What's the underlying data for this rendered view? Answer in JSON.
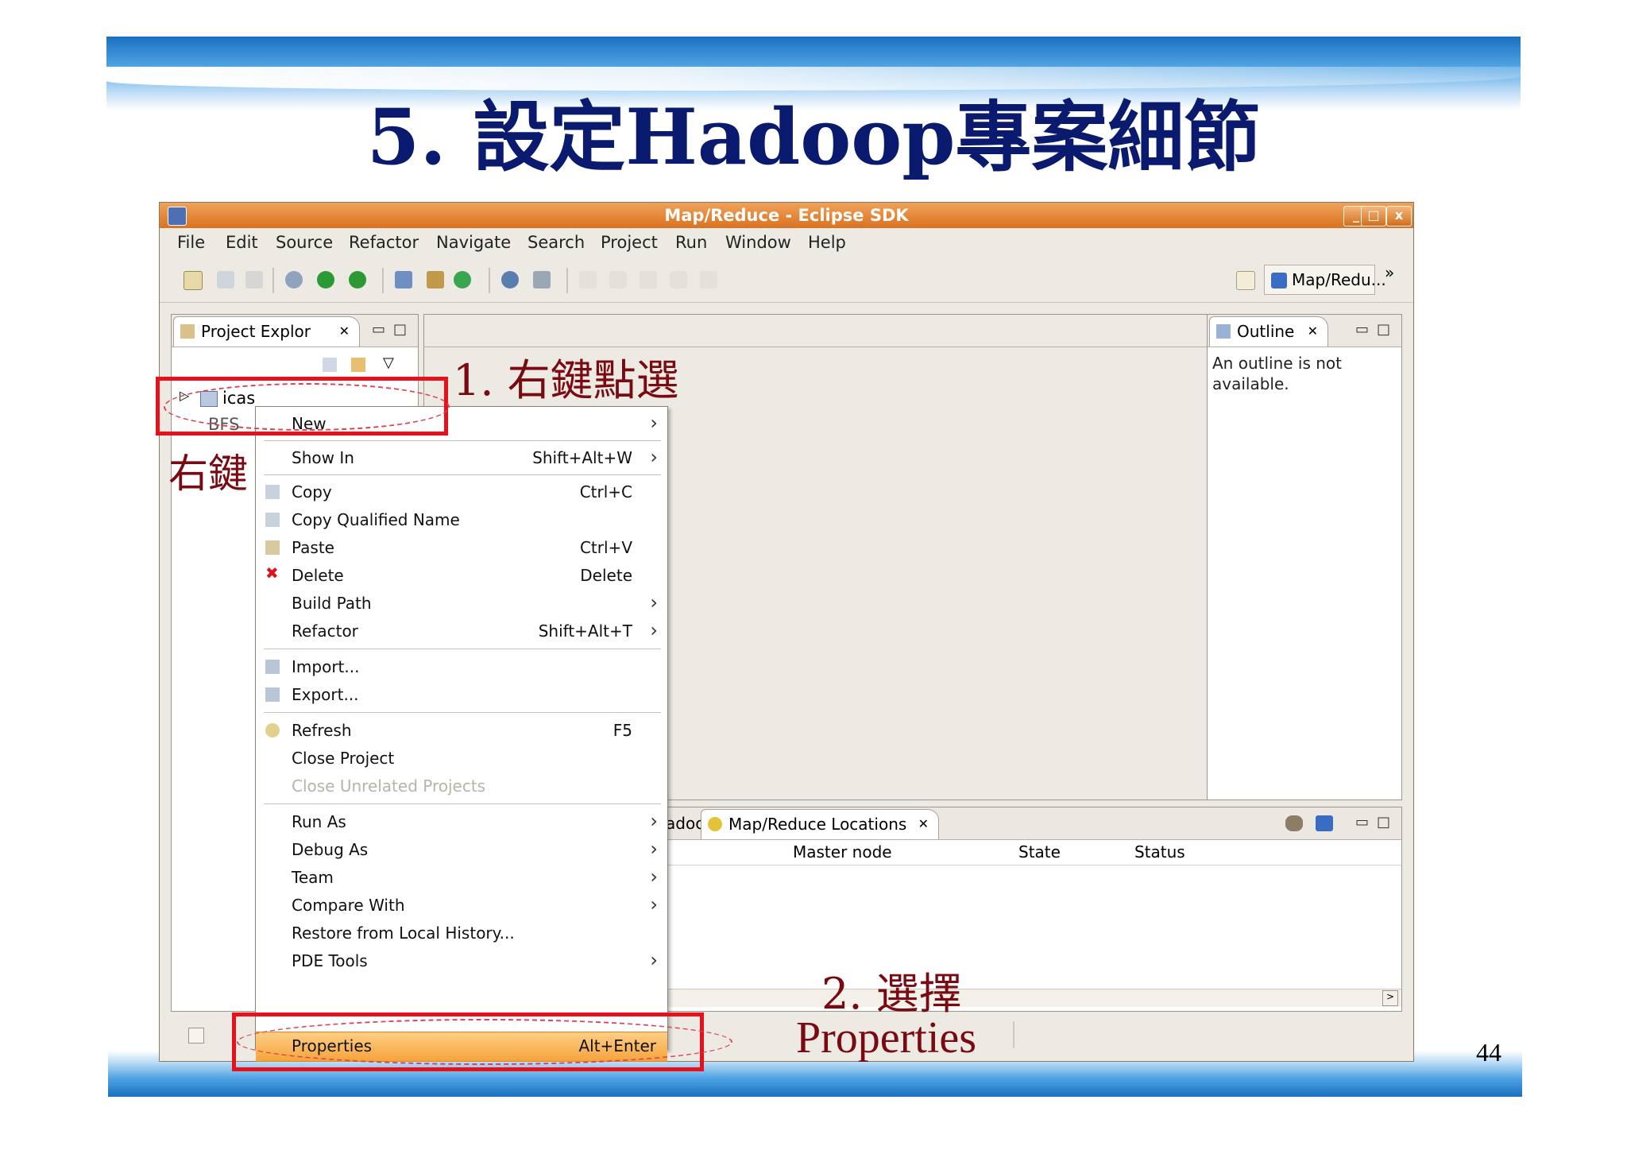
{
  "slide": {
    "title": "5. 設定Hadoop專案細節",
    "page_number": "44"
  },
  "window": {
    "title": "Map/Reduce - Eclipse SDK",
    "controls": [
      "_",
      "□",
      "x"
    ]
  },
  "menubar": [
    "File",
    "Edit",
    "Source",
    "Refactor",
    "Navigate",
    "Search",
    "Project",
    "Run",
    "Window",
    "Help"
  ],
  "toolbar": {
    "perspective_label": "Map/Redu...",
    "overflow": "»"
  },
  "project_explorer": {
    "tab_label": "Project Explor",
    "close": "✕",
    "items": [
      "icas",
      "BFS"
    ]
  },
  "outline": {
    "tab_label": "Outline",
    "close": "✕",
    "message": "An outline is not available."
  },
  "bottom_panel": {
    "partial_tab": "adoc",
    "tab_label": "Map/Reduce Locations",
    "close": "✕",
    "columns": [
      "Master node",
      "State",
      "Status"
    ]
  },
  "context_menu": {
    "items": [
      {
        "label": "New",
        "shortcut": "",
        "arrow": true
      },
      {
        "label": "Show In",
        "shortcut": "Shift+Alt+W",
        "arrow": true
      },
      {
        "label": "Copy",
        "shortcut": "Ctrl+C",
        "arrow": false
      },
      {
        "label": "Copy Qualified Name",
        "shortcut": "",
        "arrow": false
      },
      {
        "label": "Paste",
        "shortcut": "Ctrl+V",
        "arrow": false
      },
      {
        "label": "Delete",
        "shortcut": "Delete",
        "arrow": false
      },
      {
        "label": "Build Path",
        "shortcut": "",
        "arrow": true
      },
      {
        "label": "Refactor",
        "shortcut": "Shift+Alt+T",
        "arrow": true
      },
      {
        "label": "Import...",
        "shortcut": "",
        "arrow": false
      },
      {
        "label": "Export...",
        "shortcut": "",
        "arrow": false
      },
      {
        "label": "Refresh",
        "shortcut": "F5",
        "arrow": false
      },
      {
        "label": "Close Project",
        "shortcut": "",
        "arrow": false
      },
      {
        "label": "Close Unrelated Projects",
        "shortcut": "",
        "arrow": false
      },
      {
        "label": "Run As",
        "shortcut": "",
        "arrow": true
      },
      {
        "label": "Debug As",
        "shortcut": "",
        "arrow": true
      },
      {
        "label": "Team",
        "shortcut": "",
        "arrow": true
      },
      {
        "label": "Compare With",
        "shortcut": "",
        "arrow": true
      },
      {
        "label": "Restore from Local History...",
        "shortcut": "",
        "arrow": false
      },
      {
        "label": "PDE Tools",
        "shortcut": "",
        "arrow": true
      },
      {
        "label": "Properties",
        "shortcut": "Alt+Enter",
        "arrow": false
      }
    ]
  },
  "annotations": {
    "step1": "1. 右鍵點選",
    "right_click": "右鍵",
    "step2_line1": "2. 選擇",
    "step2_line2": "Properties"
  },
  "colors": {
    "title_blue": "#0a1a6e",
    "annotation_red": "#7a0a12",
    "highlight_box": "#e8101a",
    "titlebar_orange": "#e0802e",
    "menu_highlight": "#f5a43c"
  }
}
